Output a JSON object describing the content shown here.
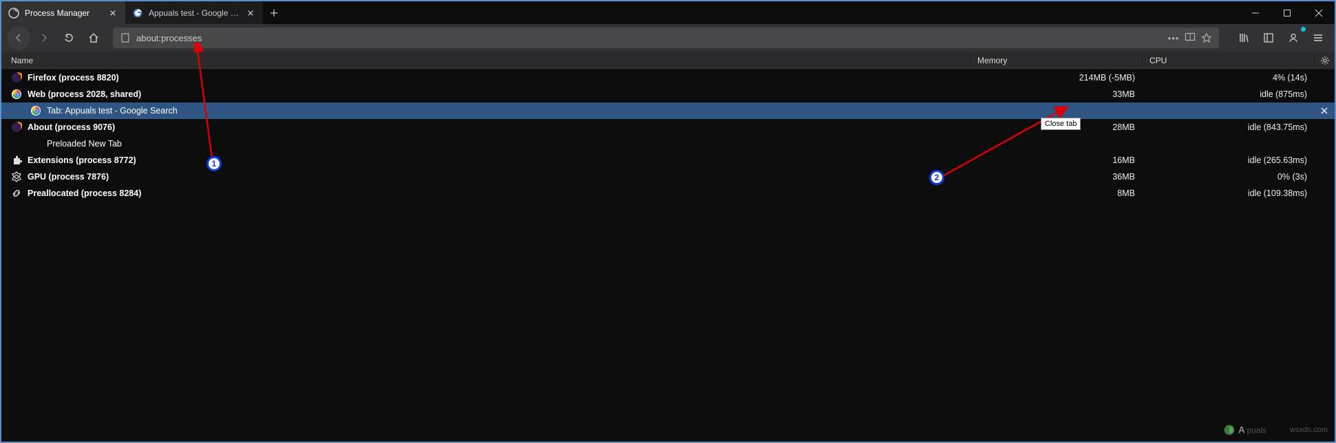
{
  "tabs": [
    {
      "title": "Process Manager",
      "active": true
    },
    {
      "title": "Appuals test - Google Search",
      "active": false
    }
  ],
  "urlbar": {
    "text": "about:processes"
  },
  "columns": {
    "name": "Name",
    "memory": "Memory",
    "cpu": "CPU"
  },
  "rows": [
    {
      "icon": "firefox",
      "label": "Firefox (process 8820)",
      "memory": "214MB (-5MB)",
      "cpu": "4% (14s)",
      "bold": true
    },
    {
      "icon": "google",
      "label": "Web (process 2028, shared)",
      "memory": "33MB",
      "cpu": "idle (875ms)",
      "bold": true
    },
    {
      "icon": "google",
      "label": "Tab: Appuals test - Google Search",
      "memory": "",
      "cpu": "",
      "indent": 1,
      "highlighted": true,
      "thin": true,
      "closable": true
    },
    {
      "icon": "firefox",
      "label": "About (process 9076)",
      "memory": "28MB",
      "cpu": "idle (843.75ms)",
      "bold": true
    },
    {
      "icon": "none",
      "label": "Preloaded New Tab",
      "memory": "",
      "cpu": "",
      "indent": 1,
      "thin": true
    },
    {
      "icon": "extension",
      "label": "Extensions (process 8772)",
      "memory": "16MB",
      "cpu": "idle (265.63ms)",
      "bold": true
    },
    {
      "icon": "gpu",
      "label": "GPU (process 7876)",
      "memory": "36MB",
      "cpu": "0% (3s)",
      "bold": true
    },
    {
      "icon": "link",
      "label": "Preallocated (process 8284)",
      "memory": "8MB",
      "cpu": "idle (109.38ms)",
      "bold": true
    }
  ],
  "tooltip": "Close tab",
  "annotations": {
    "marker1": "1",
    "marker2": "2"
  },
  "watermark": {
    "text": "wsxdn.com",
    "brand": "A puals"
  }
}
